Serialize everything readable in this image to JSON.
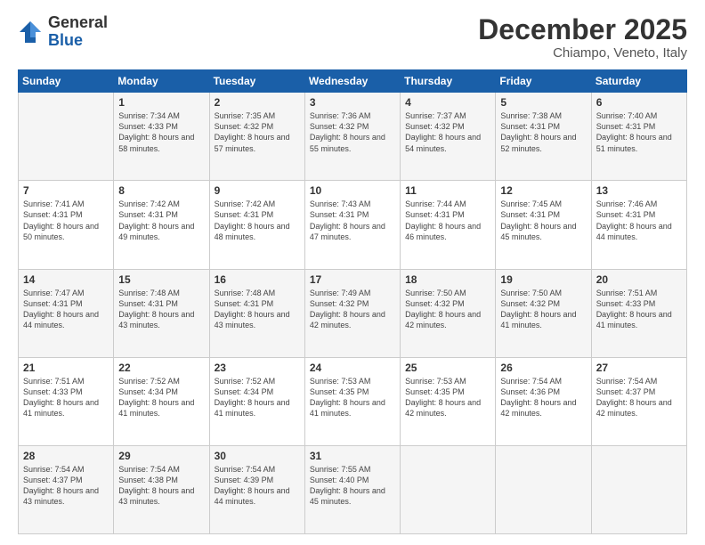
{
  "logo": {
    "general": "General",
    "blue": "Blue"
  },
  "header": {
    "month": "December 2025",
    "location": "Chiampo, Veneto, Italy"
  },
  "weekdays": [
    "Sunday",
    "Monday",
    "Tuesday",
    "Wednesday",
    "Thursday",
    "Friday",
    "Saturday"
  ],
  "weeks": [
    [
      {
        "day": "",
        "sunrise": "",
        "sunset": "",
        "daylight": ""
      },
      {
        "day": "1",
        "sunrise": "Sunrise: 7:34 AM",
        "sunset": "Sunset: 4:33 PM",
        "daylight": "Daylight: 8 hours and 58 minutes."
      },
      {
        "day": "2",
        "sunrise": "Sunrise: 7:35 AM",
        "sunset": "Sunset: 4:32 PM",
        "daylight": "Daylight: 8 hours and 57 minutes."
      },
      {
        "day": "3",
        "sunrise": "Sunrise: 7:36 AM",
        "sunset": "Sunset: 4:32 PM",
        "daylight": "Daylight: 8 hours and 55 minutes."
      },
      {
        "day": "4",
        "sunrise": "Sunrise: 7:37 AM",
        "sunset": "Sunset: 4:32 PM",
        "daylight": "Daylight: 8 hours and 54 minutes."
      },
      {
        "day": "5",
        "sunrise": "Sunrise: 7:38 AM",
        "sunset": "Sunset: 4:31 PM",
        "daylight": "Daylight: 8 hours and 52 minutes."
      },
      {
        "day": "6",
        "sunrise": "Sunrise: 7:40 AM",
        "sunset": "Sunset: 4:31 PM",
        "daylight": "Daylight: 8 hours and 51 minutes."
      }
    ],
    [
      {
        "day": "7",
        "sunrise": "Sunrise: 7:41 AM",
        "sunset": "Sunset: 4:31 PM",
        "daylight": "Daylight: 8 hours and 50 minutes."
      },
      {
        "day": "8",
        "sunrise": "Sunrise: 7:42 AM",
        "sunset": "Sunset: 4:31 PM",
        "daylight": "Daylight: 8 hours and 49 minutes."
      },
      {
        "day": "9",
        "sunrise": "Sunrise: 7:42 AM",
        "sunset": "Sunset: 4:31 PM",
        "daylight": "Daylight: 8 hours and 48 minutes."
      },
      {
        "day": "10",
        "sunrise": "Sunrise: 7:43 AM",
        "sunset": "Sunset: 4:31 PM",
        "daylight": "Daylight: 8 hours and 47 minutes."
      },
      {
        "day": "11",
        "sunrise": "Sunrise: 7:44 AM",
        "sunset": "Sunset: 4:31 PM",
        "daylight": "Daylight: 8 hours and 46 minutes."
      },
      {
        "day": "12",
        "sunrise": "Sunrise: 7:45 AM",
        "sunset": "Sunset: 4:31 PM",
        "daylight": "Daylight: 8 hours and 45 minutes."
      },
      {
        "day": "13",
        "sunrise": "Sunrise: 7:46 AM",
        "sunset": "Sunset: 4:31 PM",
        "daylight": "Daylight: 8 hours and 44 minutes."
      }
    ],
    [
      {
        "day": "14",
        "sunrise": "Sunrise: 7:47 AM",
        "sunset": "Sunset: 4:31 PM",
        "daylight": "Daylight: 8 hours and 44 minutes."
      },
      {
        "day": "15",
        "sunrise": "Sunrise: 7:48 AM",
        "sunset": "Sunset: 4:31 PM",
        "daylight": "Daylight: 8 hours and 43 minutes."
      },
      {
        "day": "16",
        "sunrise": "Sunrise: 7:48 AM",
        "sunset": "Sunset: 4:31 PM",
        "daylight": "Daylight: 8 hours and 43 minutes."
      },
      {
        "day": "17",
        "sunrise": "Sunrise: 7:49 AM",
        "sunset": "Sunset: 4:32 PM",
        "daylight": "Daylight: 8 hours and 42 minutes."
      },
      {
        "day": "18",
        "sunrise": "Sunrise: 7:50 AM",
        "sunset": "Sunset: 4:32 PM",
        "daylight": "Daylight: 8 hours and 42 minutes."
      },
      {
        "day": "19",
        "sunrise": "Sunrise: 7:50 AM",
        "sunset": "Sunset: 4:32 PM",
        "daylight": "Daylight: 8 hours and 41 minutes."
      },
      {
        "day": "20",
        "sunrise": "Sunrise: 7:51 AM",
        "sunset": "Sunset: 4:33 PM",
        "daylight": "Daylight: 8 hours and 41 minutes."
      }
    ],
    [
      {
        "day": "21",
        "sunrise": "Sunrise: 7:51 AM",
        "sunset": "Sunset: 4:33 PM",
        "daylight": "Daylight: 8 hours and 41 minutes."
      },
      {
        "day": "22",
        "sunrise": "Sunrise: 7:52 AM",
        "sunset": "Sunset: 4:34 PM",
        "daylight": "Daylight: 8 hours and 41 minutes."
      },
      {
        "day": "23",
        "sunrise": "Sunrise: 7:52 AM",
        "sunset": "Sunset: 4:34 PM",
        "daylight": "Daylight: 8 hours and 41 minutes."
      },
      {
        "day": "24",
        "sunrise": "Sunrise: 7:53 AM",
        "sunset": "Sunset: 4:35 PM",
        "daylight": "Daylight: 8 hours and 41 minutes."
      },
      {
        "day": "25",
        "sunrise": "Sunrise: 7:53 AM",
        "sunset": "Sunset: 4:35 PM",
        "daylight": "Daylight: 8 hours and 42 minutes."
      },
      {
        "day": "26",
        "sunrise": "Sunrise: 7:54 AM",
        "sunset": "Sunset: 4:36 PM",
        "daylight": "Daylight: 8 hours and 42 minutes."
      },
      {
        "day": "27",
        "sunrise": "Sunrise: 7:54 AM",
        "sunset": "Sunset: 4:37 PM",
        "daylight": "Daylight: 8 hours and 42 minutes."
      }
    ],
    [
      {
        "day": "28",
        "sunrise": "Sunrise: 7:54 AM",
        "sunset": "Sunset: 4:37 PM",
        "daylight": "Daylight: 8 hours and 43 minutes."
      },
      {
        "day": "29",
        "sunrise": "Sunrise: 7:54 AM",
        "sunset": "Sunset: 4:38 PM",
        "daylight": "Daylight: 8 hours and 43 minutes."
      },
      {
        "day": "30",
        "sunrise": "Sunrise: 7:54 AM",
        "sunset": "Sunset: 4:39 PM",
        "daylight": "Daylight: 8 hours and 44 minutes."
      },
      {
        "day": "31",
        "sunrise": "Sunrise: 7:55 AM",
        "sunset": "Sunset: 4:40 PM",
        "daylight": "Daylight: 8 hours and 45 minutes."
      },
      {
        "day": "",
        "sunrise": "",
        "sunset": "",
        "daylight": ""
      },
      {
        "day": "",
        "sunrise": "",
        "sunset": "",
        "daylight": ""
      },
      {
        "day": "",
        "sunrise": "",
        "sunset": "",
        "daylight": ""
      }
    ]
  ]
}
